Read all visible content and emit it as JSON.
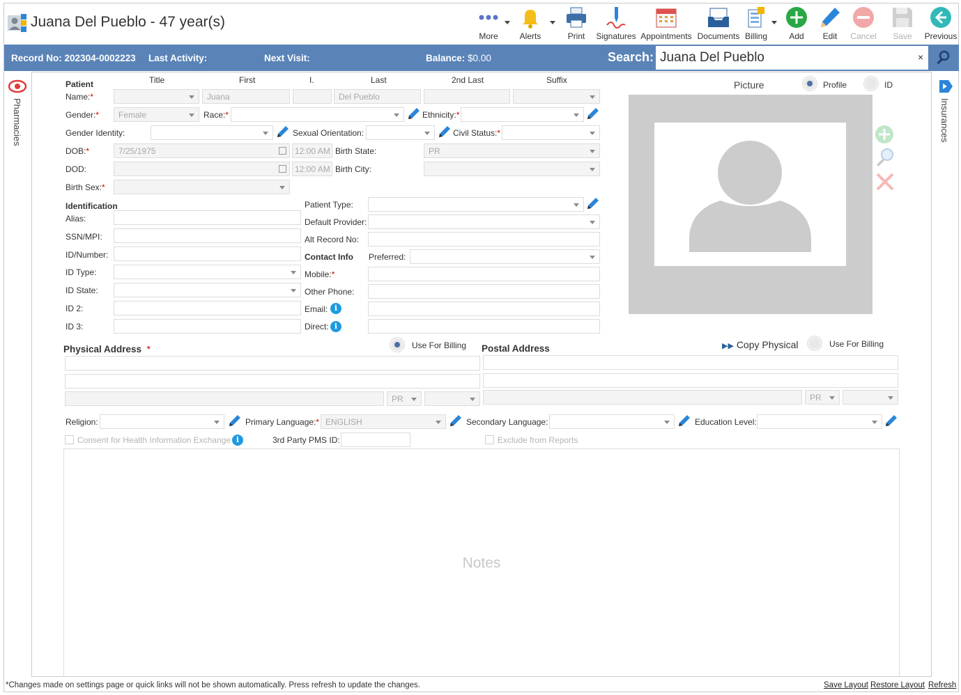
{
  "header": {
    "title": "Juana Del Pueblo - 47 year(s)",
    "toolbar": {
      "more": "More",
      "alerts": "Alerts",
      "print": "Print",
      "signatures": "Signatures",
      "appointments": "Appointments",
      "documents": "Documents",
      "billing": "Billing",
      "add": "Add",
      "edit": "Edit",
      "cancel": "Cancel",
      "save": "Save",
      "previous": "Previous"
    }
  },
  "bar": {
    "record_label": "Record No:",
    "record_value": "202304-0002223",
    "last_activity_label": "Last Activity:",
    "next_visit_label": "Next Visit:",
    "balance_label": "Balance:",
    "balance_value": "$0.00",
    "search_label": "Search:",
    "search_value": "Juana Del Pueblo",
    "search_clear": "×"
  },
  "side": {
    "left_label": "Pharmacies",
    "right_label": "Insurances"
  },
  "patient": {
    "section_title": "Patient",
    "col_title": "Title",
    "col_first": "First",
    "col_initial": "I.",
    "col_last": "Last",
    "col_2nd_last": "2nd Last",
    "col_suffix": "Suffix",
    "name_label": "Name:",
    "first_value": "Juana",
    "last_value": "Del Pueblo",
    "gender_label": "Gender:",
    "gender_value": "Female",
    "race_label": "Race:",
    "ethnicity_label": "Ethnicity:",
    "gender_identity_label": "Gender Identity:",
    "sexual_orientation_label": "Sexual Orientation:",
    "civil_status_label": "Civil Status:",
    "dob_label": "DOB:",
    "dob_value": "7/25/1975",
    "dob_time": "12:00 AM",
    "birth_state_label": "Birth State:",
    "birth_state_value": "PR",
    "dod_label": "DOD:",
    "dod_time": "12:00 AM",
    "birth_city_label": "Birth City:",
    "birth_sex_label": "Birth Sex:",
    "required_mark": "*"
  },
  "identification": {
    "section_title": "Identification",
    "alias_label": "Alias:",
    "ssn_label": "SSN/MPI:",
    "id_number_label": "ID/Number:",
    "id_type_label": "ID Type:",
    "id_state_label": "ID State:",
    "id2_label": "ID 2:",
    "id3_label": "ID 3:"
  },
  "misc": {
    "patient_type_label": "Patient Type:",
    "default_provider_label": "Default Provider:",
    "alt_record_label": "Alt Record No:"
  },
  "contact": {
    "section_title": "Contact Info",
    "preferred_label": "Preferred:",
    "mobile_label": "Mobile:",
    "other_phone_label": "Other Phone:",
    "email_label": "Email:",
    "direct_label": "Direct:",
    "info_glyph": "i"
  },
  "picture": {
    "label": "Picture",
    "profile_label": "Profile",
    "id_label": "ID"
  },
  "address": {
    "physical_title": "Physical Address",
    "postal_title": "Postal Address",
    "use_for_billing": "Use For Billing",
    "copy_physical": "Copy Physical",
    "state_value": "PR"
  },
  "lower": {
    "religion_label": "Religion:",
    "primary_language_label": "Primary Language:",
    "primary_language_value": "ENGLISH",
    "secondary_language_label": "Secondary Language:",
    "education_level_label": "Education Level:",
    "consent_label": "Consent for Health Information Exchange",
    "third_party_label": "3rd Party PMS ID:",
    "exclude_label": "Exclude from Reports",
    "notes_placeholder": "Notes"
  },
  "footer": {
    "note": "*Changes made on settings page or quick links will not be shown automatically. Press refresh to update the changes.",
    "save_layout": "Save Layout",
    "restore_layout": "Restore Layout",
    "refresh": "Refresh"
  }
}
